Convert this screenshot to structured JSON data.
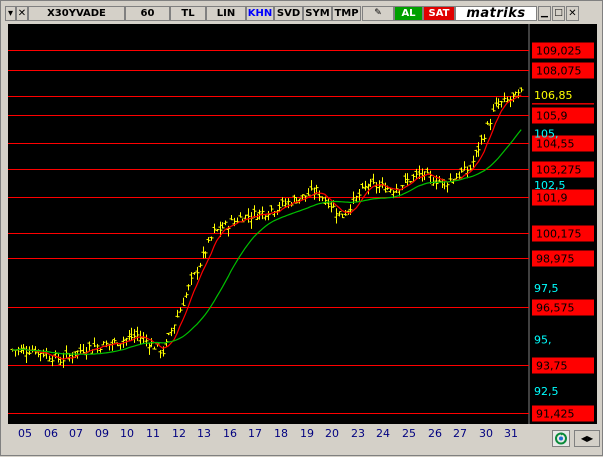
{
  "toolbar": {
    "symbol": "X30YVADE",
    "period": "60",
    "currency": "TL",
    "scale": "LIN",
    "khn": "KHN",
    "svd": "SVD",
    "sym": "SYM",
    "tmp": "TMP",
    "buy": "AL",
    "sell": "SAT",
    "brand": "matriks"
  },
  "colors": {
    "background": "#000000",
    "price_bars": "#ffff00",
    "fast_ma": "#ff0000",
    "slow_ma": "#00c000",
    "level_lines": "#ff0000",
    "red_label_bg": "#ff0000",
    "axis_label_text": "#00ffff"
  },
  "chart_data": {
    "type": "bar",
    "title": "",
    "ylim": [
      90.9,
      110.3
    ],
    "levels": [
      {
        "value": 109.025,
        "label": "109,025",
        "style": "red"
      },
      {
        "value": 108.075,
        "label": "108,075",
        "style": "red"
      },
      {
        "value": 106.8,
        "label": "106,8",
        "style": "red"
      },
      {
        "value": 105.9,
        "label": "105,9",
        "style": "red"
      },
      {
        "value": 104.55,
        "label": "104,55",
        "style": "red"
      },
      {
        "value": 103.275,
        "label": "103,275",
        "style": "red"
      },
      {
        "value": 101.9,
        "label": "101,9",
        "style": "red"
      },
      {
        "value": 100.175,
        "label": "100,175",
        "style": "red"
      },
      {
        "value": 98.975,
        "label": "98,975",
        "style": "red"
      },
      {
        "value": 96.575,
        "label": "96,575",
        "style": "red"
      },
      {
        "value": 93.75,
        "label": "93,75",
        "style": "red"
      },
      {
        "value": 91.425,
        "label": "91,425",
        "style": "red"
      }
    ],
    "axis_labels": [
      {
        "value": 105.0,
        "label": "105,"
      },
      {
        "value": 102.5,
        "label": "102,5"
      },
      {
        "value": 97.5,
        "label": "97,5"
      },
      {
        "value": 95.0,
        "label": "95,"
      },
      {
        "value": 92.5,
        "label": "92,5"
      }
    ],
    "last_price": {
      "value": 106.85,
      "label": "106,85"
    },
    "x_labels": [
      "05",
      "06",
      "07",
      "09",
      "10",
      "11",
      "12",
      "13",
      "16",
      "17",
      "18",
      "19",
      "20",
      "23",
      "24",
      "25",
      "26",
      "27",
      "30",
      "31"
    ],
    "daily_close": [
      94.5,
      94.0,
      94.6,
      94.8,
      95.2,
      94.4,
      97.5,
      100.2,
      100.9,
      101.2,
      101.7,
      102.2,
      101.0,
      102.5,
      102.3,
      103.0,
      102.6,
      103.3,
      106.3,
      106.9
    ],
    "series": [
      {
        "name": "",
        "role": "price",
        "color": "#ffff00"
      },
      {
        "name": "",
        "role": "fast_ma",
        "color": "#ff0000"
      },
      {
        "name": "",
        "role": "slow_ma",
        "color": "#00c000"
      }
    ]
  }
}
